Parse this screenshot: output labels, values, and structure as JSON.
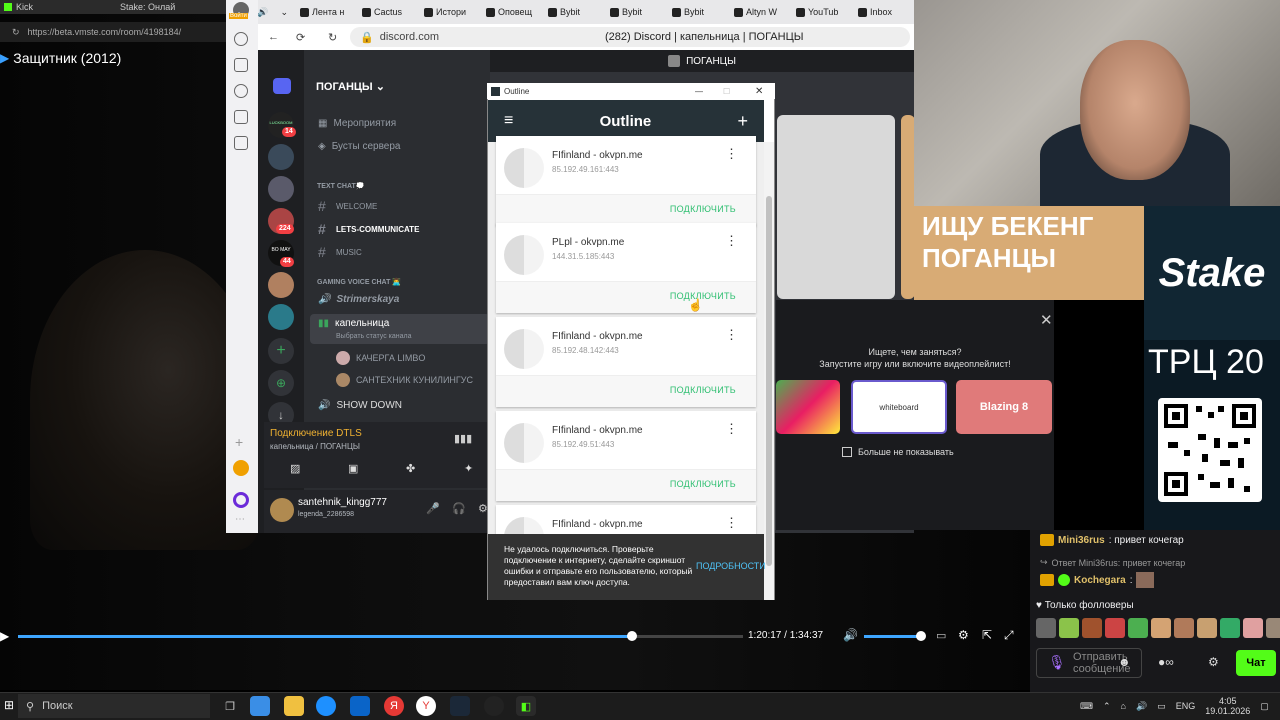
{
  "video": {
    "title": "Защитник (2012)",
    "time_current": "1:20:17",
    "time_total": "1:34:37",
    "progress": 0.847,
    "volume": 1.0
  },
  "kick_browser": {
    "tabs": [
      "Kick",
      "Stake: Онлай"
    ],
    "url": "https://beta.vmste.com/room/4198184/"
  },
  "browser": {
    "tabs": [
      "Лента н",
      "Cactus",
      "Истори",
      "Оповещ",
      "Bybit",
      "Bybit",
      "Bybit",
      "Altyn W",
      "YouTub",
      "Inbox"
    ],
    "address": "discord.com",
    "page_title": "(282) Discord | капельница | ПОГАНЦЫ",
    "side_label": "Войти"
  },
  "discord": {
    "server_name": "ПОГАНЦЫ",
    "top_title": "ПОГАНЦЫ",
    "events": "Мероприятия",
    "boosts": "Бусты сервера",
    "text_category": "TEXT CHAT💭",
    "channels": [
      "WELCOME",
      "LETS-COMMUNICATE",
      "MUSIC"
    ],
    "voice_category": "GAMING VOICE CHAT 👨‍💻",
    "voice_channels": [
      "Strimerskaya",
      "капельница",
      "SHOW DOWN"
    ],
    "voice_status": "Выбрать статус канала",
    "voice_users": [
      "КАЧЕРГА LIMBO",
      "САНТЕХНИК КУНИЛИНГУС"
    ],
    "badges": [
      "14",
      "224",
      "44"
    ],
    "server_icon_texts": [
      "LUCKBOOM",
      "BO MAY"
    ],
    "connection_status": "Подключение DTLS",
    "connection_sub": "капельница / ПОГАНЦЫ",
    "username": "santehnik_kingg777",
    "user_tag": "legenda_2286598"
  },
  "outline": {
    "window_title": "Outline",
    "header_title": "Outline",
    "servers": [
      {
        "name": "FIfinland - okvpn.me",
        "ip": "85.192.49.161:443",
        "action": "ПОДКЛЮЧИТЬ"
      },
      {
        "name": "PLpl - okvpn.me",
        "ip": "144.31.5.185:443",
        "action": "ПОДКЛЮЧИТЬ"
      },
      {
        "name": "FIfinland - okvpn.me",
        "ip": "85.192.48.142:443",
        "action": "ПОДКЛЮЧИТЬ"
      },
      {
        "name": "FIfinland - okvpn.me",
        "ip": "85.192.49.51:443",
        "action": "ПОДКЛЮЧИТЬ"
      },
      {
        "name": "FIfinland - okvpn.me",
        "ip": "",
        "action": ""
      }
    ],
    "toast": "Не удалось подключиться. Проверьте подключение к интернету, сделайте скриншот ошибки и отправьте его пользователю, который предоставил вам ключ доступа.",
    "toast_action": "ПОДРОБНОСТИ"
  },
  "suggest": {
    "question": "Ищете, чем заняться?",
    "hint": "Запустите игру или включите видеоплейлист!",
    "games": [
      "",
      "whiteboard",
      "Blazing 8"
    ],
    "dont_show": "Больше не показывать"
  },
  "stream_overlay": {
    "promo": "ИЩУ БЕКЕНГ ПОГАНЦЫ",
    "stake": "Stake",
    "trc": "ТРЦ 20"
  },
  "chat": {
    "messages": [
      {
        "user": "Mini36rus",
        "text": ": привет кочегар"
      },
      {
        "user": "",
        "text": "Ответ Mini36rus: привет кочегар"
      },
      {
        "user": "Kochegara",
        "text": ":"
      }
    ],
    "followers_label": "Только фолловеры",
    "input_placeholder": "Отправить сообщение",
    "send_label": "Чат"
  },
  "taskbar": {
    "search": "Поиск",
    "lang": "ENG",
    "time": "4:05",
    "date": "19.01.2026"
  }
}
